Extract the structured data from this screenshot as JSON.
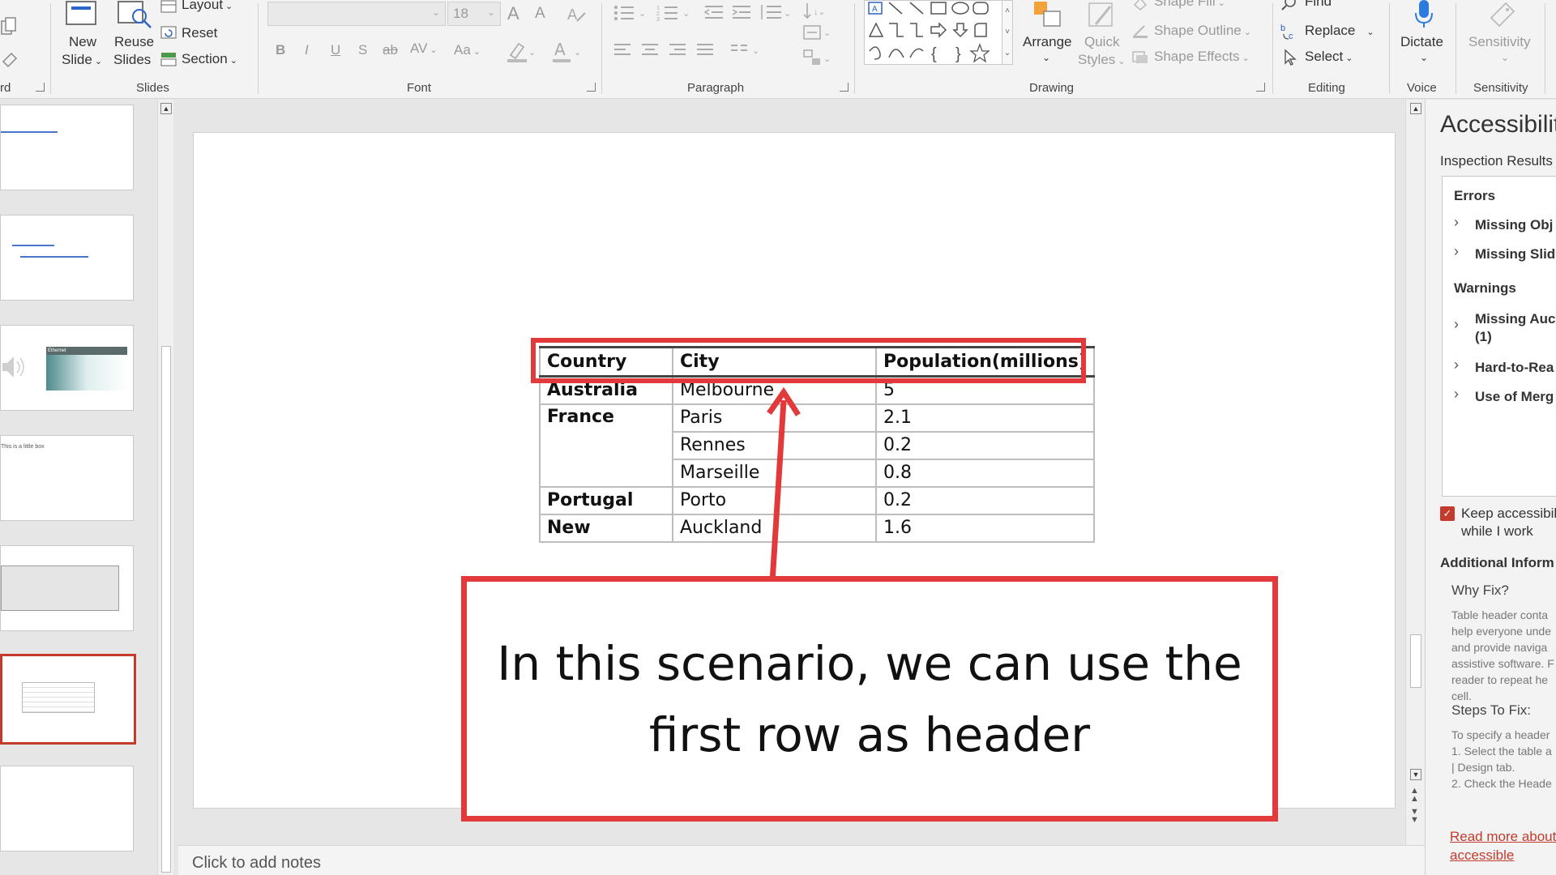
{
  "ribbon": {
    "slides_group": {
      "new_slide": [
        "New",
        "Slide"
      ],
      "reuse_slides": [
        "Reuse",
        "Slides"
      ],
      "layout": "Layout",
      "reset": "Reset",
      "section": "Section",
      "label": "Slides",
      "clipboard_tail": "rd"
    },
    "font_group": {
      "font_name": "",
      "font_size": "18",
      "bold": "B",
      "italic": "I",
      "underline": "U",
      "shadow": "S",
      "strike": "ab",
      "spacing": "AV",
      "case": "Aa",
      "grow": "A",
      "shrink": "A",
      "label": "Font"
    },
    "paragraph_group": {
      "label": "Paragraph"
    },
    "drawing_group": {
      "arrange": "Arrange",
      "quick_styles": [
        "Quick",
        "Styles"
      ],
      "shape_fill": "Shape Fill",
      "shape_outline": "Shape Outline",
      "shape_effects": "Shape Effects",
      "label": "Drawing"
    },
    "editing_group": {
      "find": "Find",
      "replace": "Replace",
      "select": "Select",
      "label": "Editing"
    },
    "voice_group": {
      "dictate": "Dictate",
      "label": "Voice"
    },
    "sensitivity_group": {
      "sensitivity": "Sensitivity",
      "label": "Sensitivity"
    }
  },
  "thumbnails": {
    "slide5_heading": "Ethernet",
    "slide4_text": "This is a little box"
  },
  "slide": {
    "table": {
      "headers": [
        "Country",
        "City",
        "Population(millions)"
      ],
      "rows": [
        [
          "Australia",
          "Melbourne",
          "5"
        ],
        [
          "France",
          "Paris",
          "2.1"
        ],
        [
          "",
          "Rennes",
          "0.2"
        ],
        [
          "",
          "Marseille",
          "0.8"
        ],
        [
          "Portugal",
          "Porto",
          "0.2"
        ],
        [
          "New",
          "Auckland",
          "1.6"
        ]
      ]
    },
    "callout": "In this scenario, we can use the first row as header"
  },
  "notes": {
    "placeholder": "Click to add notes"
  },
  "accessibility": {
    "title": "Accessibilit",
    "inspection_results": "Inspection Results",
    "errors_label": "Errors",
    "errors": [
      "Missing Obj",
      "Missing Slid"
    ],
    "warnings_label": "Warnings",
    "warnings": [
      [
        "Missing Auc",
        "(1)"
      ],
      [
        "Hard-to-Rea",
        ""
      ],
      [
        "Use of Merg",
        ""
      ]
    ],
    "keep_checking": [
      "Keep accessibili",
      "while I work"
    ],
    "additional_info": "Additional Inform",
    "why_fix": "Why Fix?",
    "why_fix_text": [
      "Table header conta",
      "help everyone unde",
      "and provide naviga",
      "assistive software. F",
      "reader to repeat he",
      "cell."
    ],
    "steps_label": "Steps To Fix:",
    "steps_text": [
      "To specify a header",
      "1. Select the table a",
      "| Design tab.",
      "2. Check the Heade"
    ],
    "read_more": [
      "Read more about",
      "accessible"
    ]
  },
  "colors": {
    "highlight_red": "#e23a3a",
    "accent_blue": "#2b63c6"
  }
}
